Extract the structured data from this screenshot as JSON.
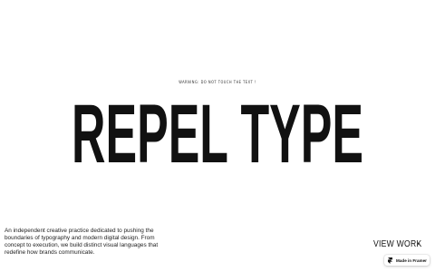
{
  "page": {
    "warning": "WARNING: DO NOT TOUCH THE TEXT !",
    "hero_title": "REPEL TYPE",
    "description": "An independent creative practice dedicated to pushing the boundaries of typography and modern digital design. From concept to execution, we build distinct visual languages that redefine how brands communicate."
  },
  "cta": {
    "view_work_label": "VIEW WORK",
    "icon": "arrow-right-icon"
  },
  "badge": {
    "label": "Made in Framer",
    "icon": "framer-logo-icon"
  },
  "colors": {
    "text": "#111111",
    "background": "#ffffff"
  }
}
